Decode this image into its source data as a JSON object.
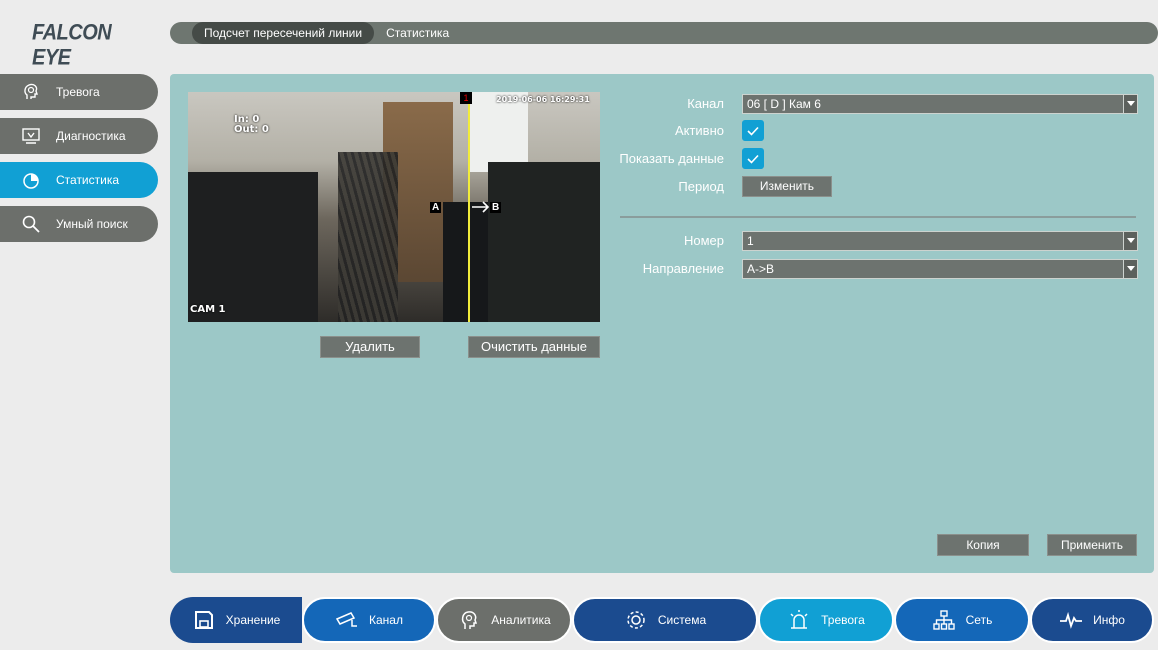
{
  "brand": {
    "logo": "FALCON EYE"
  },
  "tabs": [
    {
      "label": "Подсчет пересечений линии",
      "active": true
    },
    {
      "label": "Статистика",
      "active": false
    }
  ],
  "sidebar": {
    "items": [
      {
        "label": "Тревога",
        "icon": "alarm-head-icon",
        "active": false
      },
      {
        "label": "Диагностика",
        "icon": "diagnostics-icon",
        "active": false
      },
      {
        "label": "Статистика",
        "icon": "pie-chart-icon",
        "active": true
      },
      {
        "label": "Умный поиск",
        "icon": "search-icon",
        "active": false
      }
    ]
  },
  "preview": {
    "counter_in": "In: 0",
    "counter_out": "Out: 0",
    "timestamp": "2019-06-06 16:29:31",
    "camera_name": "CAM 1",
    "marker_a": "A",
    "marker_b": "B",
    "line_id": "1"
  },
  "actions": {
    "delete": "Удалить",
    "clear": "Очистить данные",
    "copy": "Копия",
    "apply": "Применить"
  },
  "form": {
    "channel_label": "Канал",
    "channel_value": "06 [ D ] Кам 6",
    "active_label": "Активно",
    "active_checked": true,
    "show_data_label": "Показать данные",
    "show_data_checked": true,
    "period_label": "Период",
    "period_button": "Изменить",
    "number_label": "Номер",
    "number_value": "1",
    "direction_label": "Направление",
    "direction_value": "A->B"
  },
  "bottom_nav": [
    {
      "label": "Хранение",
      "icon": "save-icon",
      "color": "#1b4b8f"
    },
    {
      "label": "Канал",
      "icon": "camera-icon",
      "color": "#1467b8"
    },
    {
      "label": "Аналитика",
      "icon": "analytics-head-icon",
      "color": "#6c6f6b"
    },
    {
      "label": "Система",
      "icon": "gear-icon",
      "color": "#1b4b8f"
    },
    {
      "label": "Тревога",
      "icon": "alarm-icon",
      "color": "#11a0d4"
    },
    {
      "label": "Сеть",
      "icon": "network-icon",
      "color": "#1467b8"
    },
    {
      "label": "Инфо",
      "icon": "pulse-icon",
      "color": "#1b4b8f"
    }
  ],
  "colors": {
    "accent": "#11a0d4",
    "panel": "#9cc8c7",
    "button": "#6d736f"
  }
}
